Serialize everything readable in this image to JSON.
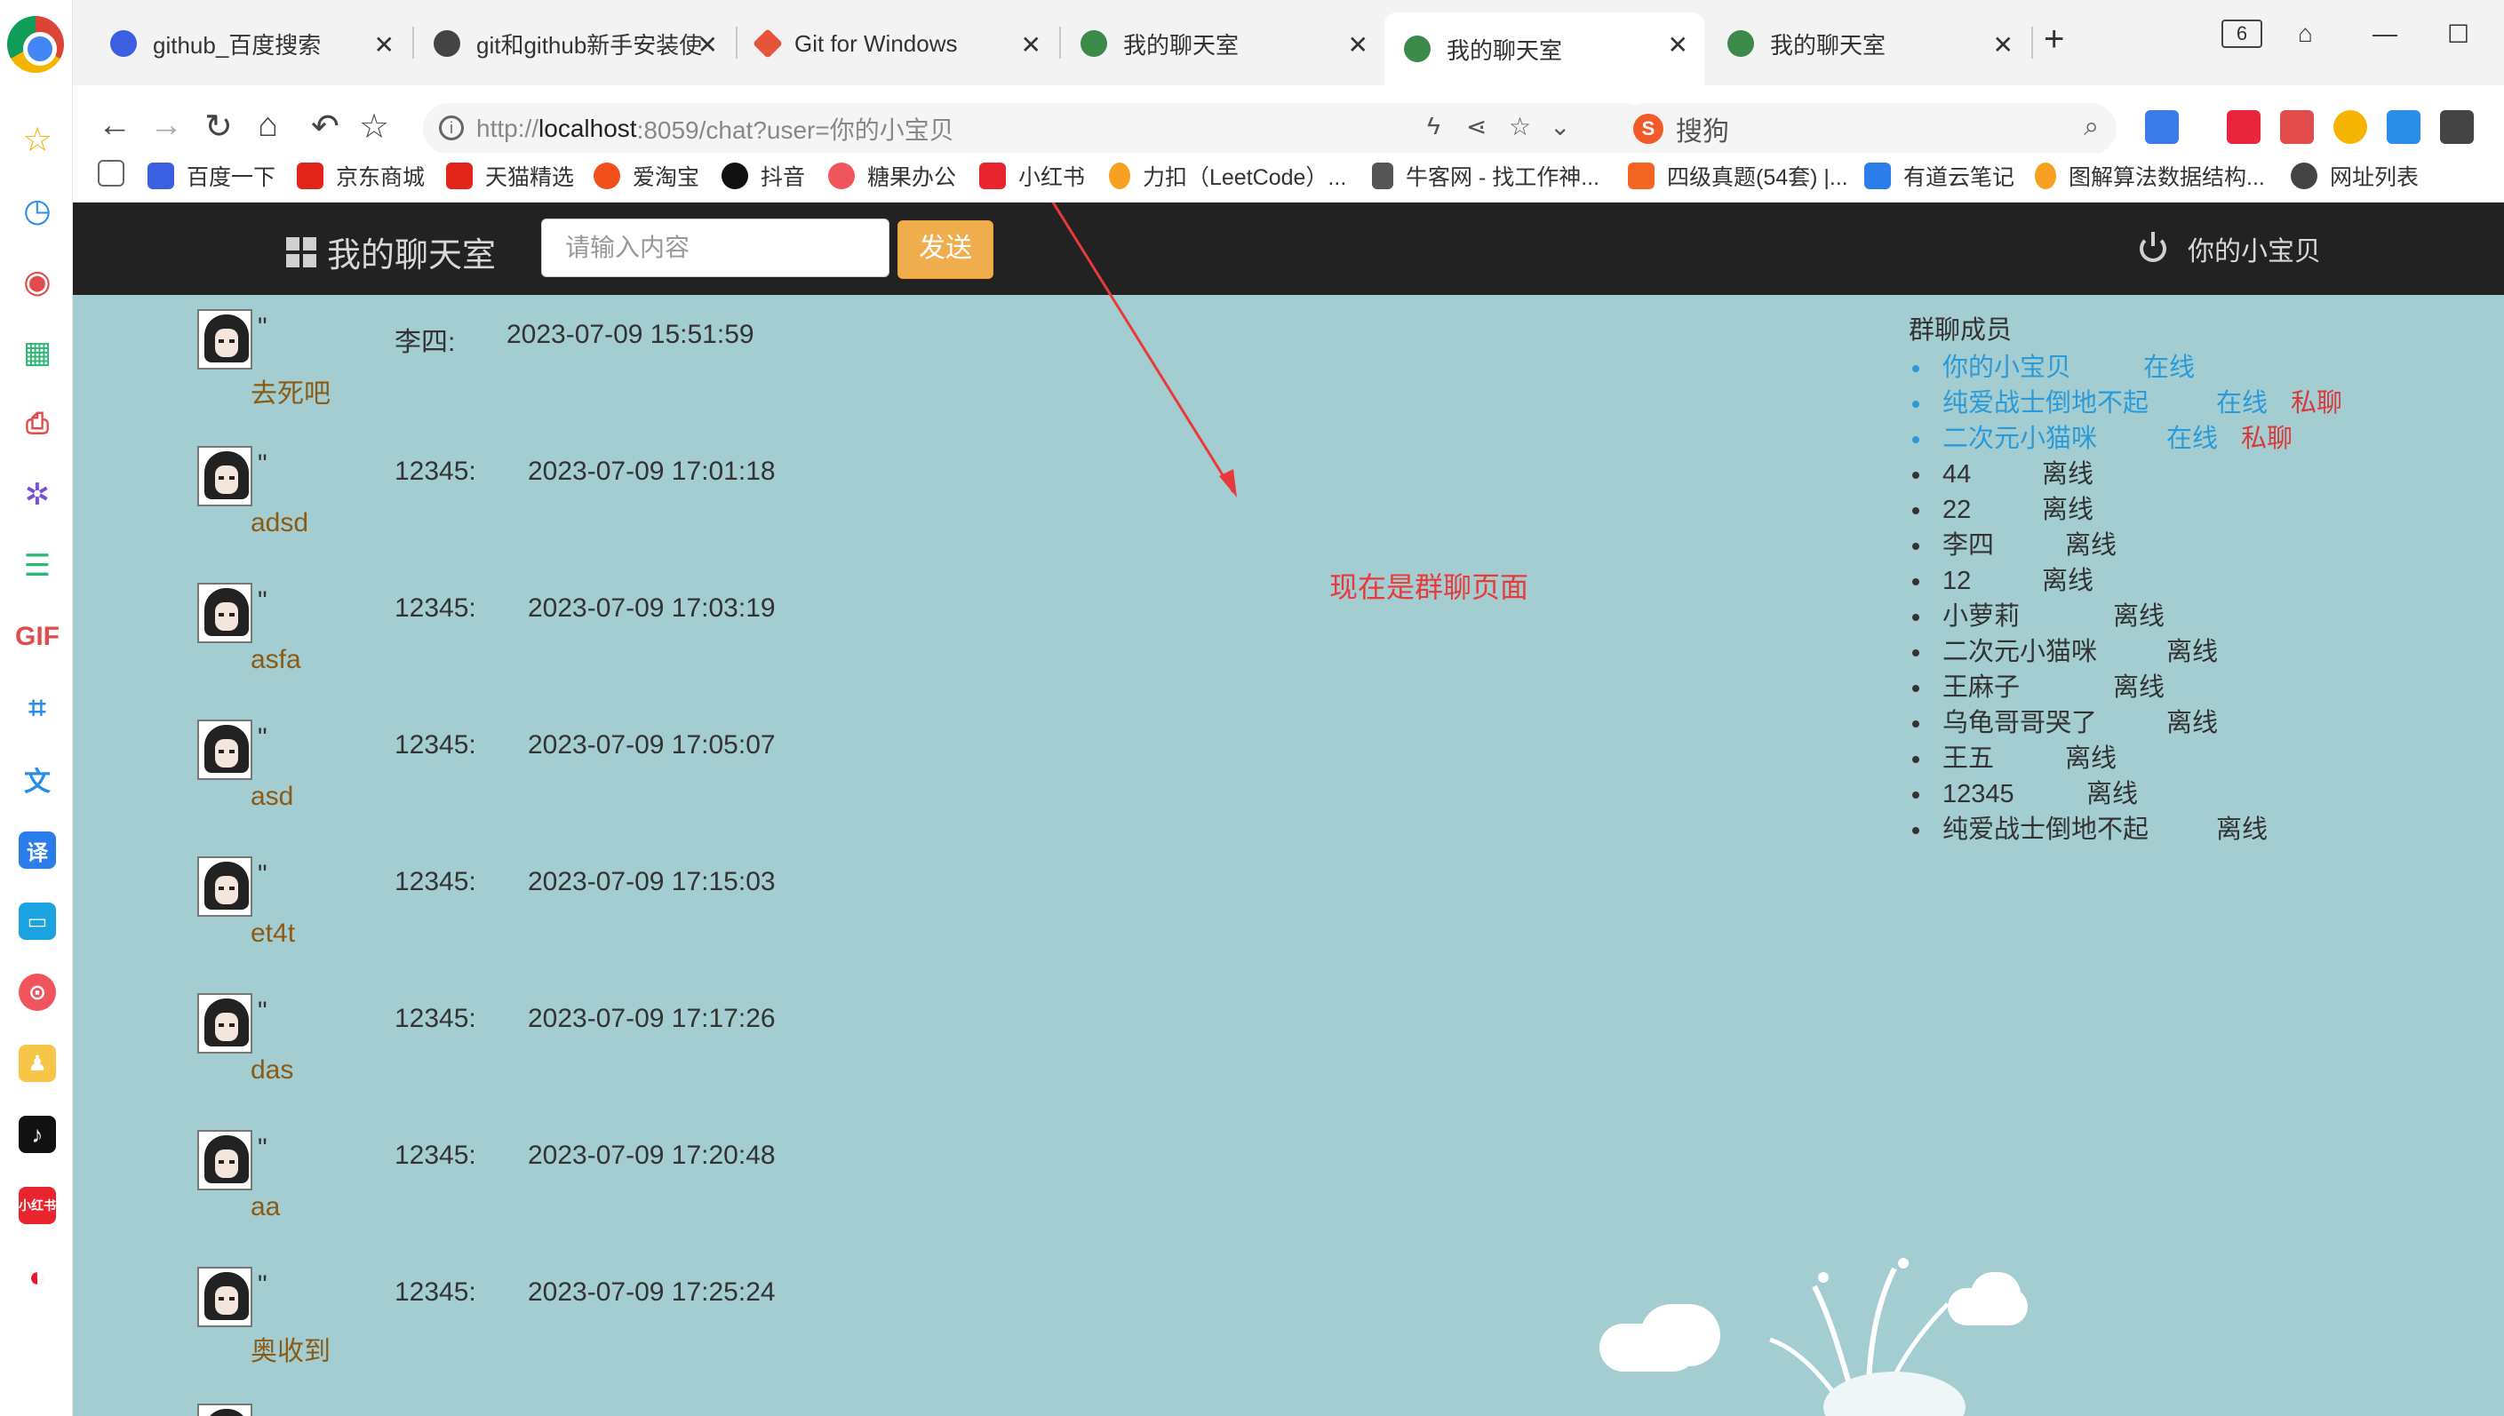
{
  "browser": {
    "tabs": [
      {
        "title": "github_百度搜索",
        "active": false
      },
      {
        "title": "git和github新手安装使",
        "active": false
      },
      {
        "title": "Git for Windows",
        "active": false
      },
      {
        "title": "我的聊天室",
        "active": false
      },
      {
        "title": "我的聊天室",
        "active": true
      },
      {
        "title": "我的聊天室",
        "active": false
      }
    ],
    "tab_count": "6",
    "address_scheme": "http://",
    "address_host": "localhost",
    "address_rest": ":8059/chat?user=你的小宝贝",
    "search_engine": "搜狗",
    "bookmarks": [
      "百度一下",
      "京东商城",
      "天猫精选",
      "爱淘宝",
      "抖音",
      "糖果办公",
      "小红书",
      "力扣（LeetCode）...",
      "牛客网 - 找工作神...",
      "四级真题(54套) |...",
      "有道云笔记",
      "图解算法数据结构...",
      "网址列表"
    ]
  },
  "app": {
    "brand": "我的聊天室",
    "input_placeholder": "请输入内容",
    "send_label": "发送",
    "current_user": "你的小宝贝"
  },
  "messages": [
    {
      "quote": "\"",
      "sender": "李四:",
      "time": "2023-07-09 15:51:59",
      "text": "去死吧"
    },
    {
      "quote": "\"",
      "sender": "12345:",
      "time": "2023-07-09 17:01:18",
      "text": "adsd"
    },
    {
      "quote": "\"",
      "sender": "12345:",
      "time": "2023-07-09 17:03:19",
      "text": "asfa"
    },
    {
      "quote": "\"",
      "sender": "12345:",
      "time": "2023-07-09 17:05:07",
      "text": "asd"
    },
    {
      "quote": "\"",
      "sender": "12345:",
      "time": "2023-07-09 17:15:03",
      "text": "et4t"
    },
    {
      "quote": "\"",
      "sender": "12345:",
      "time": "2023-07-09 17:17:26",
      "text": "das"
    },
    {
      "quote": "\"",
      "sender": "12345:",
      "time": "2023-07-09 17:20:48",
      "text": "aa"
    },
    {
      "quote": "\"",
      "sender": "12345:",
      "time": "2023-07-09 17:25:24",
      "text": "奥收到"
    }
  ],
  "annotation": "现在是群聊页面",
  "members_title": "群聊成员",
  "members": [
    {
      "name": "你的小宝贝",
      "status": "在线",
      "pm": ""
    },
    {
      "name": "纯爱战士倒地不起",
      "status": "在线",
      "pm": "私聊"
    },
    {
      "name": "二次元小猫咪",
      "status": "在线",
      "pm": "私聊"
    },
    {
      "name": "44",
      "status": "离线",
      "pm": ""
    },
    {
      "name": "22",
      "status": "离线",
      "pm": ""
    },
    {
      "name": "李四",
      "status": "离线",
      "pm": ""
    },
    {
      "name": "12",
      "status": "离线",
      "pm": ""
    },
    {
      "name": "小萝莉",
      "status": "离线",
      "pm": ""
    },
    {
      "name": "二次元小猫咪",
      "status": "离线",
      "pm": ""
    },
    {
      "name": "王麻子",
      "status": "离线",
      "pm": ""
    },
    {
      "name": "乌龟哥哥哭了",
      "status": "离线",
      "pm": ""
    },
    {
      "name": "王五",
      "status": "离线",
      "pm": ""
    },
    {
      "name": "12345",
      "status": "离线",
      "pm": ""
    },
    {
      "name": "纯爱战士倒地不起",
      "status": "离线",
      "pm": ""
    }
  ],
  "colors": {
    "page_bg": "#a3cdd1",
    "navbar_bg": "#222222",
    "send_button": "#f0ad4e",
    "online": "#2b9ad8",
    "private_chat": "#d93a3a",
    "message_text": "#8b5a14",
    "annotation": "#e83a3a"
  }
}
